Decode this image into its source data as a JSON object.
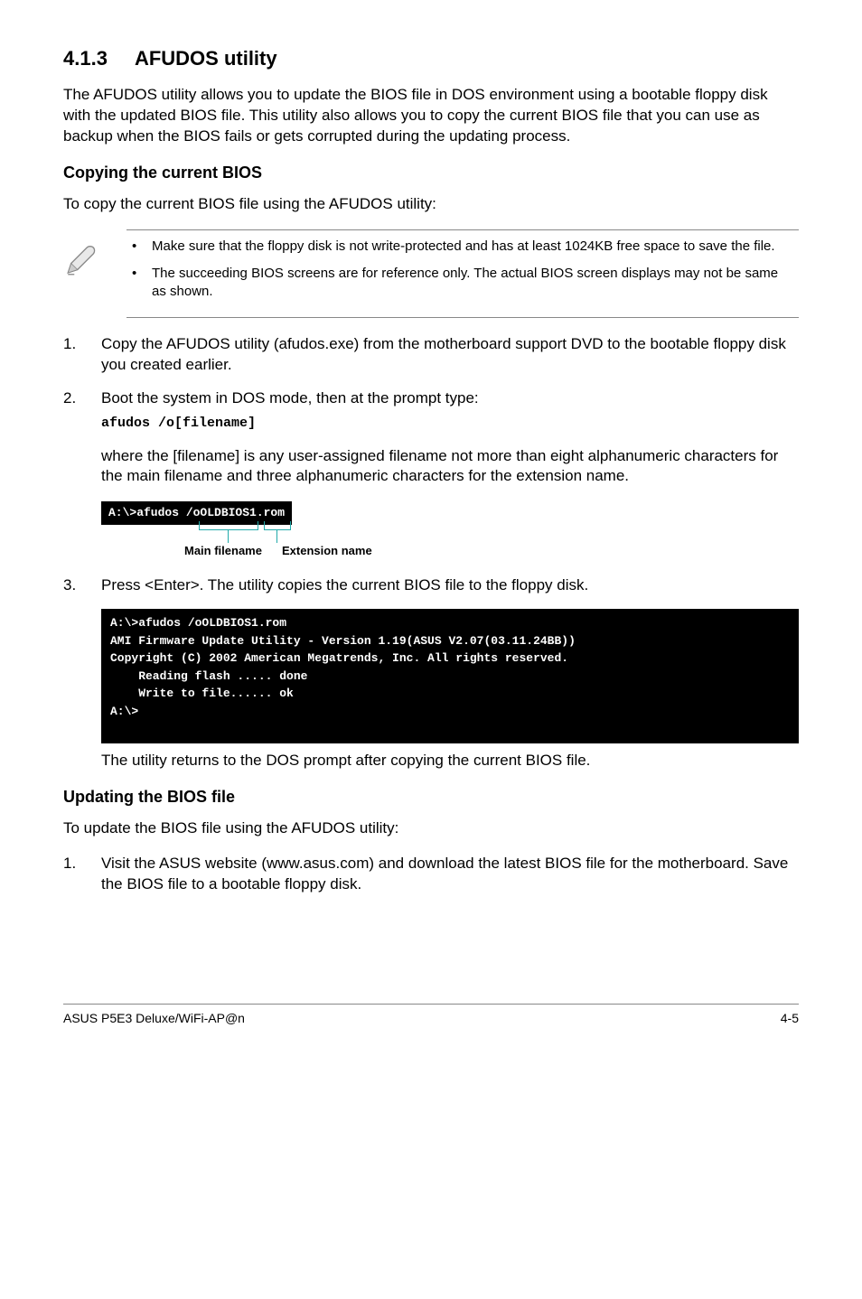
{
  "section": {
    "number": "4.1.3",
    "title": "AFUDOS utility"
  },
  "intro": "The AFUDOS utility allows you to update the BIOS file in DOS environment using a bootable floppy disk with the updated BIOS file. This utility also allows you to copy the current BIOS file that you can use as backup when the BIOS fails or gets corrupted during the updating process.",
  "copy_head": "Copying the current BIOS",
  "copy_lead": "To copy the current BIOS file using the AFUDOS utility:",
  "notes": {
    "item1": "Make sure that the floppy disk is not write-protected and has at least 1024KB free space to save the file.",
    "item2": "The succeeding BIOS screens are for reference only. The actual BIOS screen displays may not be same as shown."
  },
  "steps_a": {
    "s1": "Copy the AFUDOS utility (afudos.exe) from the motherboard support DVD to the bootable floppy disk you created earlier.",
    "s2": "Boot the system in DOS mode, then at the prompt type:",
    "s2_cmd": "afudos /o[filename]",
    "s2_desc": "where the [filename] is any user-assigned filename not more than eight alphanumeric characters  for the main filename and three alphanumeric characters for the extension name."
  },
  "fd": {
    "term": "A:\\>afudos /oOLDBIOS1.rom",
    "main": "Main filename",
    "ext": "Extension name"
  },
  "steps_b": {
    "s3": "Press <Enter>. The utility copies the current BIOS file to the floppy disk."
  },
  "term2": "A:\\>afudos /oOLDBIOS1.rom\nAMI Firmware Update Utility - Version 1.19(ASUS V2.07(03.11.24BB))\nCopyright (C) 2002 American Megatrends, Inc. All rights reserved.\n    Reading flash ..... done\n    Write to file...... ok\nA:\\>\n\n",
  "after_term": "The utility returns to the DOS prompt after copying the current BIOS file.",
  "update_head": "Updating the BIOS file",
  "update_lead": "To update the BIOS file using the AFUDOS utility:",
  "steps_c": {
    "s1": "Visit the ASUS website (www.asus.com) and download the latest BIOS file for the motherboard. Save the BIOS file to a bootable floppy disk."
  },
  "footer": {
    "left": "ASUS P5E3 Deluxe/WiFi-AP@n",
    "right": "4-5"
  }
}
